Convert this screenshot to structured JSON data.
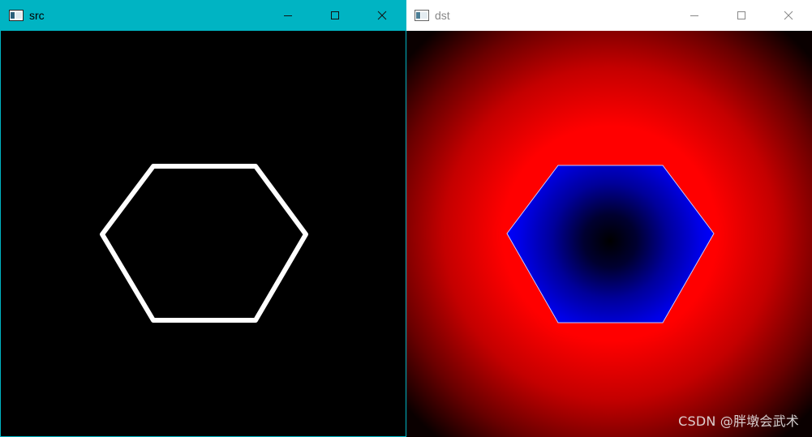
{
  "windows": [
    {
      "id": "src",
      "title": "src",
      "active": true,
      "content": "white hexagon outline on black background"
    },
    {
      "id": "dst",
      "title": "dst",
      "active": false,
      "content": "distance transform visualization: blue-to-black inside hexagon, red-to-black outside"
    }
  ],
  "colors": {
    "active_titlebar": "#00b4c3",
    "inactive_titlebar": "#ffffff",
    "inactive_title_text": "#888888",
    "hex_fill_outer": "#0000ff",
    "hex_fill_center": "#000000",
    "outside_near": "#ff0000",
    "outside_far": "#000000"
  },
  "icons": {
    "app": "window-app-icon",
    "minimize": "minimize-icon",
    "maximize": "maximize-icon",
    "close": "close-icon"
  },
  "watermark": "CSDN @胖墩会武术"
}
